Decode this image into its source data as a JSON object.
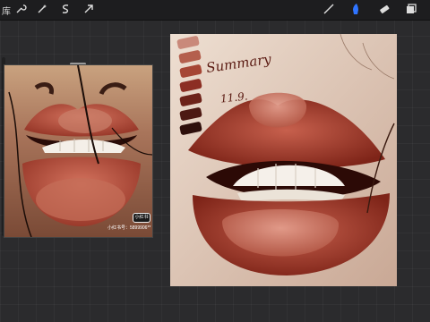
{
  "toolbar": {
    "gallery_label": "库",
    "left_icons": [
      "wrench-icon",
      "magic-wand-icon",
      "selection-icon",
      "move-arrow-icon"
    ],
    "right_icons": [
      "brush-icon",
      "smudge-icon",
      "eraser-icon",
      "layers-icon"
    ],
    "active_tool": "smudge-icon",
    "accent_color": "#2f74ff"
  },
  "reference": {
    "watermark_text": "小红书号：5899906**",
    "badge_text": "小红书"
  },
  "artwork": {
    "signature": "Summary",
    "date": "11.9.",
    "palette_colors": [
      "#c9897a",
      "#b45f4d",
      "#a64635",
      "#8c2e23",
      "#6d2219",
      "#4d1913",
      "#2e0f0b"
    ]
  }
}
